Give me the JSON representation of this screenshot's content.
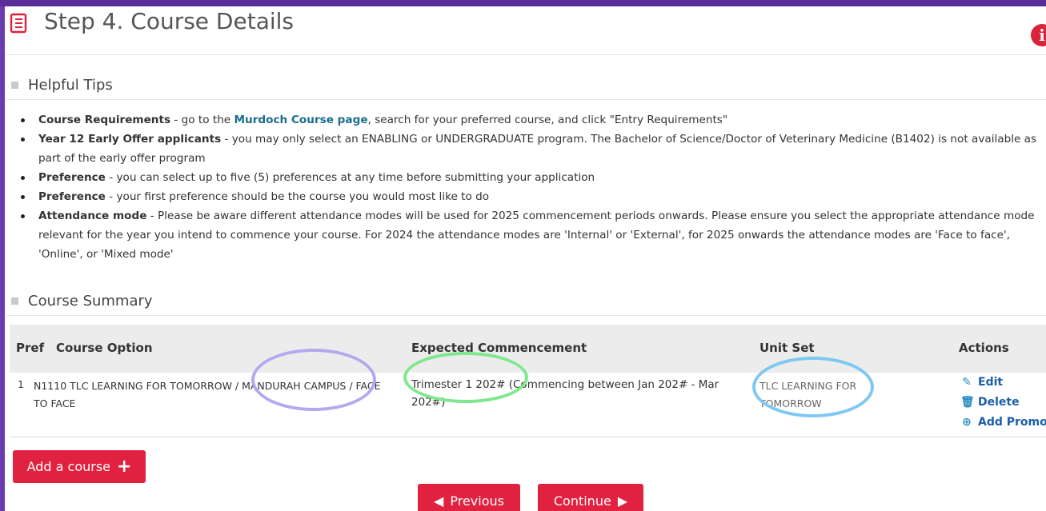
{
  "header": {
    "title": "Step 4. Course Details",
    "info_icon_glyph": "i"
  },
  "tips": {
    "heading": "Helpful Tips",
    "items": [
      {
        "bold": "Course Requirements",
        "pre": " - go to the ",
        "link": "Murdoch Course page",
        "post": ", search for your preferred course, and click \"Entry Requirements\""
      },
      {
        "bold": "Year 12 Early Offer applicants",
        "pre": " - you may only select an ENABLING or UNDERGRADUATE program. The Bachelor of Science/Doctor of Veterinary Medicine (B1402) is not available as part of the early offer program",
        "link": "",
        "post": ""
      },
      {
        "bold": "Preference",
        "pre": " - you can select up to five (5) preferences at any time before submitting your application",
        "link": "",
        "post": ""
      },
      {
        "bold": "Preference",
        "pre": " - your first preference should be the course you would most like to do",
        "link": "",
        "post": ""
      },
      {
        "bold": "Attendance mode",
        "pre": " - Please be aware different attendance modes will be used for 2025 commencement periods onwards. Please ensure you select the appropriate attendance mode relevant for the year you intend to commence your course. For 2024 the attendance modes are 'Internal' or 'External', for 2025 onwards the attendance modes are 'Face to face', 'Online', or 'Mixed mode'",
        "link": "",
        "post": ""
      }
    ]
  },
  "summary": {
    "heading": "Course Summary",
    "columns": {
      "pref": "Pref",
      "course_option": "Course Option",
      "expected": "Expected Commencement",
      "unit_set": "Unit Set",
      "actions": "Actions"
    },
    "rows": [
      {
        "pref": "1",
        "course_option": "N1110 TLC LEARNING FOR TOMORROW / MANDURAH CAMPUS / FACE TO FACE",
        "expected": "Trimester 1 202# (Commencing between Jan 202# - Mar 202#)",
        "unit_set": "TLC LEARNING FOR TOMORROW",
        "actions": {
          "edit": "Edit",
          "delete": "Delete",
          "add_promo": "Add Promo"
        }
      }
    ]
  },
  "buttons": {
    "add_course": "Add a course",
    "previous": "Previous",
    "continue": "Continue"
  },
  "colors": {
    "accent_red": "#e0213f",
    "link_blue": "#1b5fa7",
    "ring_purple": "#b7a8ee",
    "ring_green": "#7ee88e",
    "ring_blue": "#7fc8f2",
    "frame_purple": "#5b2d98"
  },
  "icons": [
    "book-icon",
    "info-icon",
    "edit-icon",
    "trash-icon",
    "plus-circle-icon",
    "plus-icon",
    "arrow-left-icon",
    "arrow-right-icon"
  ]
}
